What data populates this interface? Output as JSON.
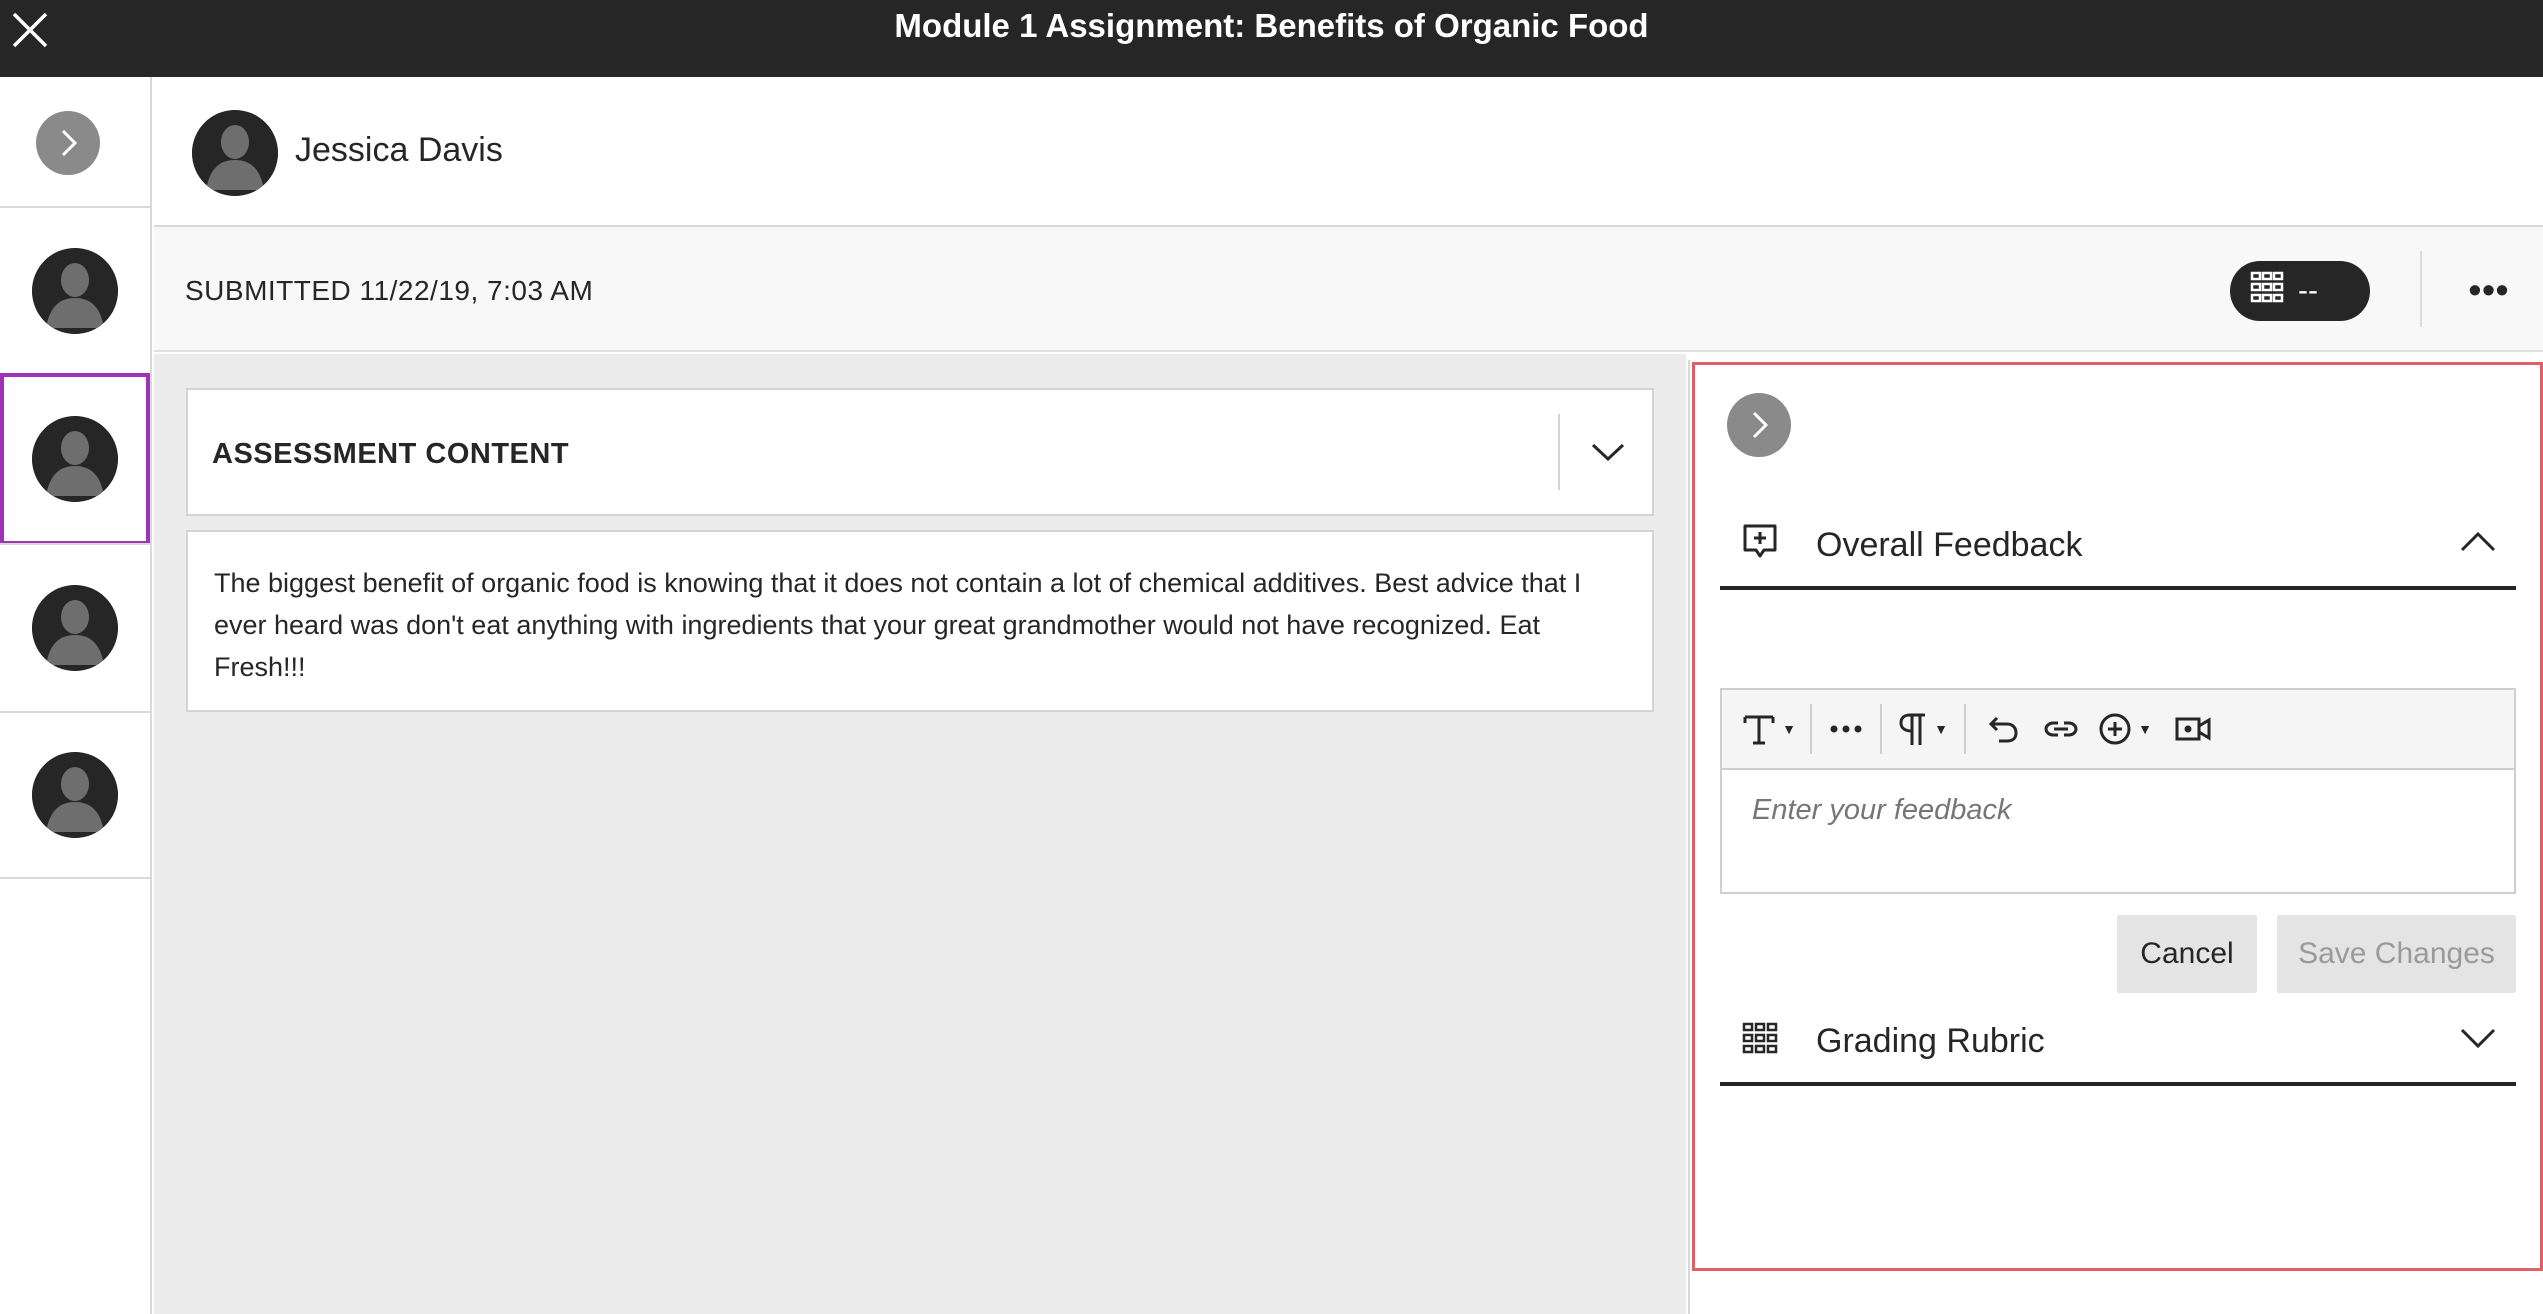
{
  "topbar": {
    "title": "Module 1 Assignment: Benefits of Organic Food",
    "close_icon": "close-icon"
  },
  "rail": {
    "toggle_icon": "chevron-right-icon",
    "students": [
      {
        "icon": "avatar-icon",
        "selected": false
      },
      {
        "icon": "avatar-icon",
        "selected": true
      },
      {
        "icon": "avatar-icon",
        "selected": false
      },
      {
        "icon": "avatar-icon",
        "selected": false
      }
    ],
    "selected_color": "#a032b8"
  },
  "student": {
    "name": "Jessica Davis"
  },
  "submission": {
    "status": "SUBMITTED 11/22/19, 7:03 AM",
    "grade": "--",
    "grade_icon": "rubric-icon",
    "more_label": "•••"
  },
  "assessment": {
    "header": "ASSESSMENT CONTENT",
    "chevron_icon": "chevron-down-icon",
    "body": "The biggest benefit of organic food is knowing that it does not contain a lot of chemical additives. Best advice that I ever heard was don't eat anything with ingredients that your great grandmother would not have recognized. Eat Fresh!!!"
  },
  "feedback_panel": {
    "collapse_icon": "chevron-right-icon",
    "overall_feedback": {
      "label": "Overall Feedback",
      "icon": "add-feedback-icon",
      "chevron_icon": "chevron-up-icon"
    },
    "editor": {
      "placeholder": "Enter your feedback",
      "toolbar": [
        "text-format-icon",
        "more-icon",
        "paragraph-icon",
        "undo-icon",
        "link-icon",
        "insert-icon",
        "video-record-icon"
      ]
    },
    "cancel_label": "Cancel",
    "save_label": "Save Changes",
    "grading_rubric": {
      "label": "Grading Rubric",
      "icon": "rubric-icon",
      "chevron_icon": "chevron-down-icon"
    },
    "highlight_color": "#e0606a"
  },
  "colors": {
    "topbar": "#262626",
    "main_bg": "#ececec",
    "pill_bg": "#262626"
  }
}
